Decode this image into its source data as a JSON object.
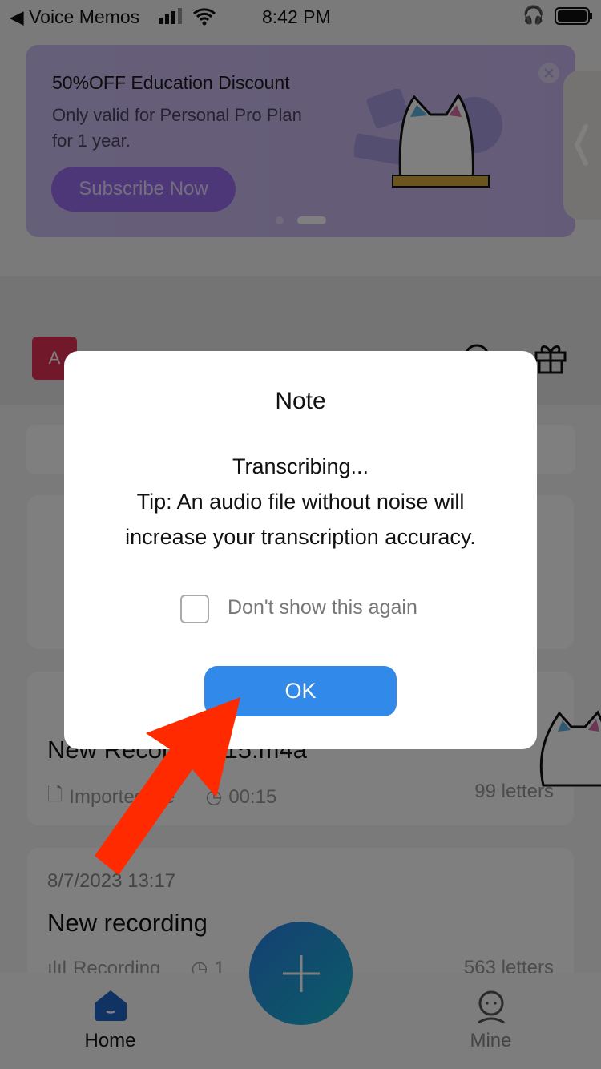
{
  "status_bar": {
    "back_app": "◀ Voice Memos",
    "time": "8:42 PM"
  },
  "banner": {
    "title": "50%OFF Education Discount",
    "subtitle": "Only valid for Personal Pro Plan for 1 year.",
    "button": "Subscribe Now",
    "page_index": 2,
    "page_count": 2
  },
  "header": {
    "avatar_letter": "A"
  },
  "recordings": [
    {
      "title": "New Recording 15.m4a",
      "source": "Imported file",
      "duration": "00:15",
      "letters": "99 letters"
    },
    {
      "date": "8/7/2023  13:17",
      "title": "New recording",
      "source": "Recording",
      "duration": "1",
      "letters": "563 letters"
    }
  ],
  "tabbar": {
    "home": "Home",
    "mine": "Mine"
  },
  "modal": {
    "title": "Note",
    "line1": "Transcribing...",
    "line2": "Tip: An audio file without noise will",
    "line3": "increase your transcription accuracy.",
    "checkbox_label": "Don't show this again",
    "checked": false,
    "ok": "OK"
  },
  "colors": {
    "accent": "#3189ea",
    "annotation_arrow": "#ff2a00",
    "banner_button": "#9a6ef0"
  }
}
